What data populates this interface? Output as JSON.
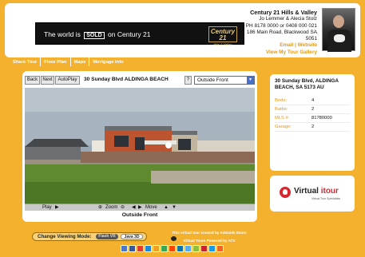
{
  "header": {
    "banner": {
      "text_before": "The world is",
      "sold_badge": "SOLD",
      "text_after": "on Century 21",
      "brand": "Century 21",
      "brand_sub": "Hills & Valley"
    },
    "agent": {
      "office": "Century 21 Hills & Valley",
      "names": "Jo Lemmer & Alecia Stolz",
      "phone": "PH 8178 0000 or 0408 000 021",
      "street": "186 Main Road, Blackwood SA",
      "postcode": "5051",
      "email_label": "Email",
      "separator": "|",
      "website_label": "Website",
      "gallery_label": "View My Tour Gallery"
    }
  },
  "nav": {
    "tabs": [
      {
        "label": "Share Tour"
      },
      {
        "label": "Floor Plan"
      },
      {
        "label": "Maps"
      },
      {
        "label": "Mortgage Info"
      }
    ]
  },
  "viewer": {
    "back_label": "Back",
    "next_label": "Next",
    "autoplay_label": "AutoPlay",
    "title": "30 Sunday Blvd ALDINGA BEACH",
    "help_label": "?",
    "selected_view": "Outside Front",
    "play_label": "Play",
    "zoom_label": "Zoom",
    "move_label": "Move",
    "caption": "Outside Front"
  },
  "details": {
    "address": "30 Sunday Blvd, ALDINGA BEACH, SA 5173 AU",
    "rows": [
      {
        "key": "Beds:",
        "value": "4"
      },
      {
        "key": "Baths:",
        "value": "2"
      },
      {
        "key": "MLS #:",
        "value": "81780000"
      },
      {
        "key": "Garage:",
        "value": "2"
      }
    ]
  },
  "vtour_logo": {
    "word_a": "Virtual",
    "word_b": "itour",
    "tagline": "Virtual Tour Specialists"
  },
  "footer": {
    "mode_label": "Change Viewing Mode:",
    "flash_label": "Flash VR",
    "java_label": "Java 3D",
    "credit_line": "This virtual tour created by Adelaide Itours",
    "powered_line": "Virtual Tours Powered by ATV"
  },
  "colors": {
    "accent": "#f4b12e",
    "link": "#e59a13",
    "brand_red": "#d7282f"
  }
}
